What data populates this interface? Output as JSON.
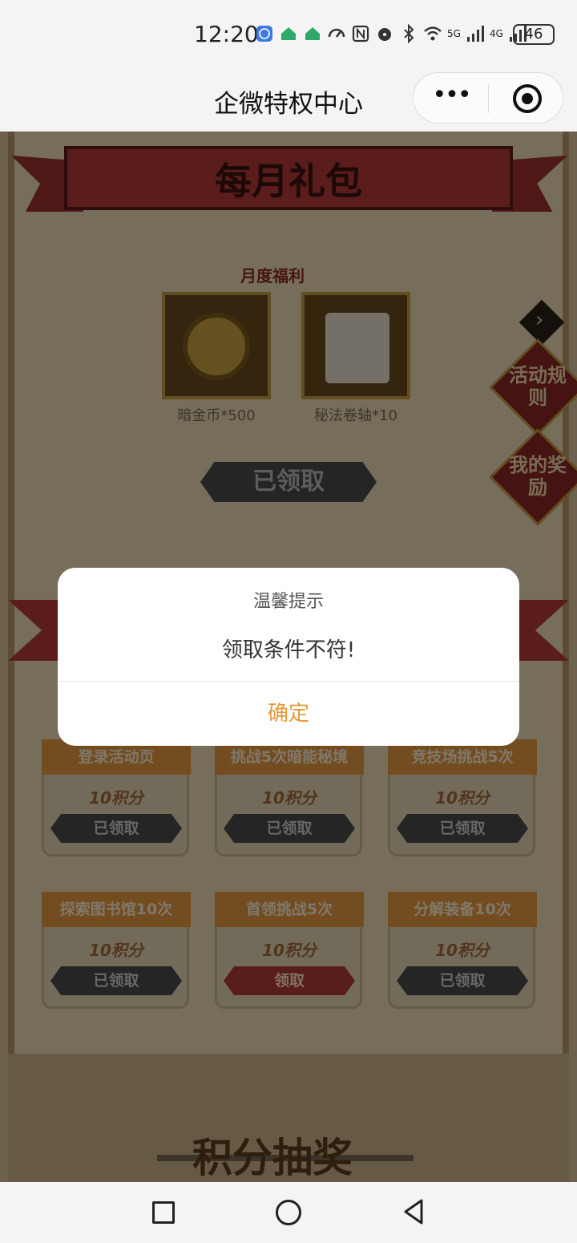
{
  "status_bar": {
    "time": "12:20",
    "battery": "46",
    "network": [
      "5G",
      "4G"
    ],
    "icons": [
      "globe-icon",
      "home-icon",
      "home-icon",
      "speedometer-icon",
      "nfc-icon",
      "alarm-icon",
      "bluetooth-icon",
      "wifi-icon",
      "signal-icon",
      "signal-icon"
    ]
  },
  "header": {
    "title": "企微特权中心",
    "more_icon": "more-dots-icon",
    "close_icon": "target-icon"
  },
  "monthly": {
    "banner": "每月礼包",
    "label": "月度福利",
    "gifts": [
      {
        "name": "暗金币*500",
        "icon": "skull-coin-icon"
      },
      {
        "name": "秘法卷轴*10",
        "icon": "scroll-icon"
      }
    ],
    "claim_status": "已领取"
  },
  "side_buttons": {
    "next": "chevron-right-icon",
    "rules": "活动规则",
    "rewards": "我的奖励"
  },
  "tasks": [
    {
      "title": "登录活动页",
      "points": "10积分",
      "button": "已领取",
      "active": false
    },
    {
      "title": "挑战5次暗能秘境",
      "points": "10积分",
      "button": "已领取",
      "active": false
    },
    {
      "title": "竞技场挑战5次",
      "points": "10积分",
      "button": "已领取",
      "active": false
    },
    {
      "title": "探索图书馆10次",
      "points": "10积分",
      "button": "已领取",
      "active": false
    },
    {
      "title": "首领挑战5次",
      "points": "10积分",
      "button": "领取",
      "active": true
    },
    {
      "title": "分解装备10次",
      "points": "10积分",
      "button": "已领取",
      "active": false
    }
  ],
  "lottery_title": "积分抽奖",
  "dialog": {
    "title": "温馨提示",
    "message": "领取条件不符!",
    "confirm": "确定"
  },
  "nav": {
    "recent": "square-icon",
    "home": "circle-icon",
    "back": "triangle-back-icon"
  }
}
